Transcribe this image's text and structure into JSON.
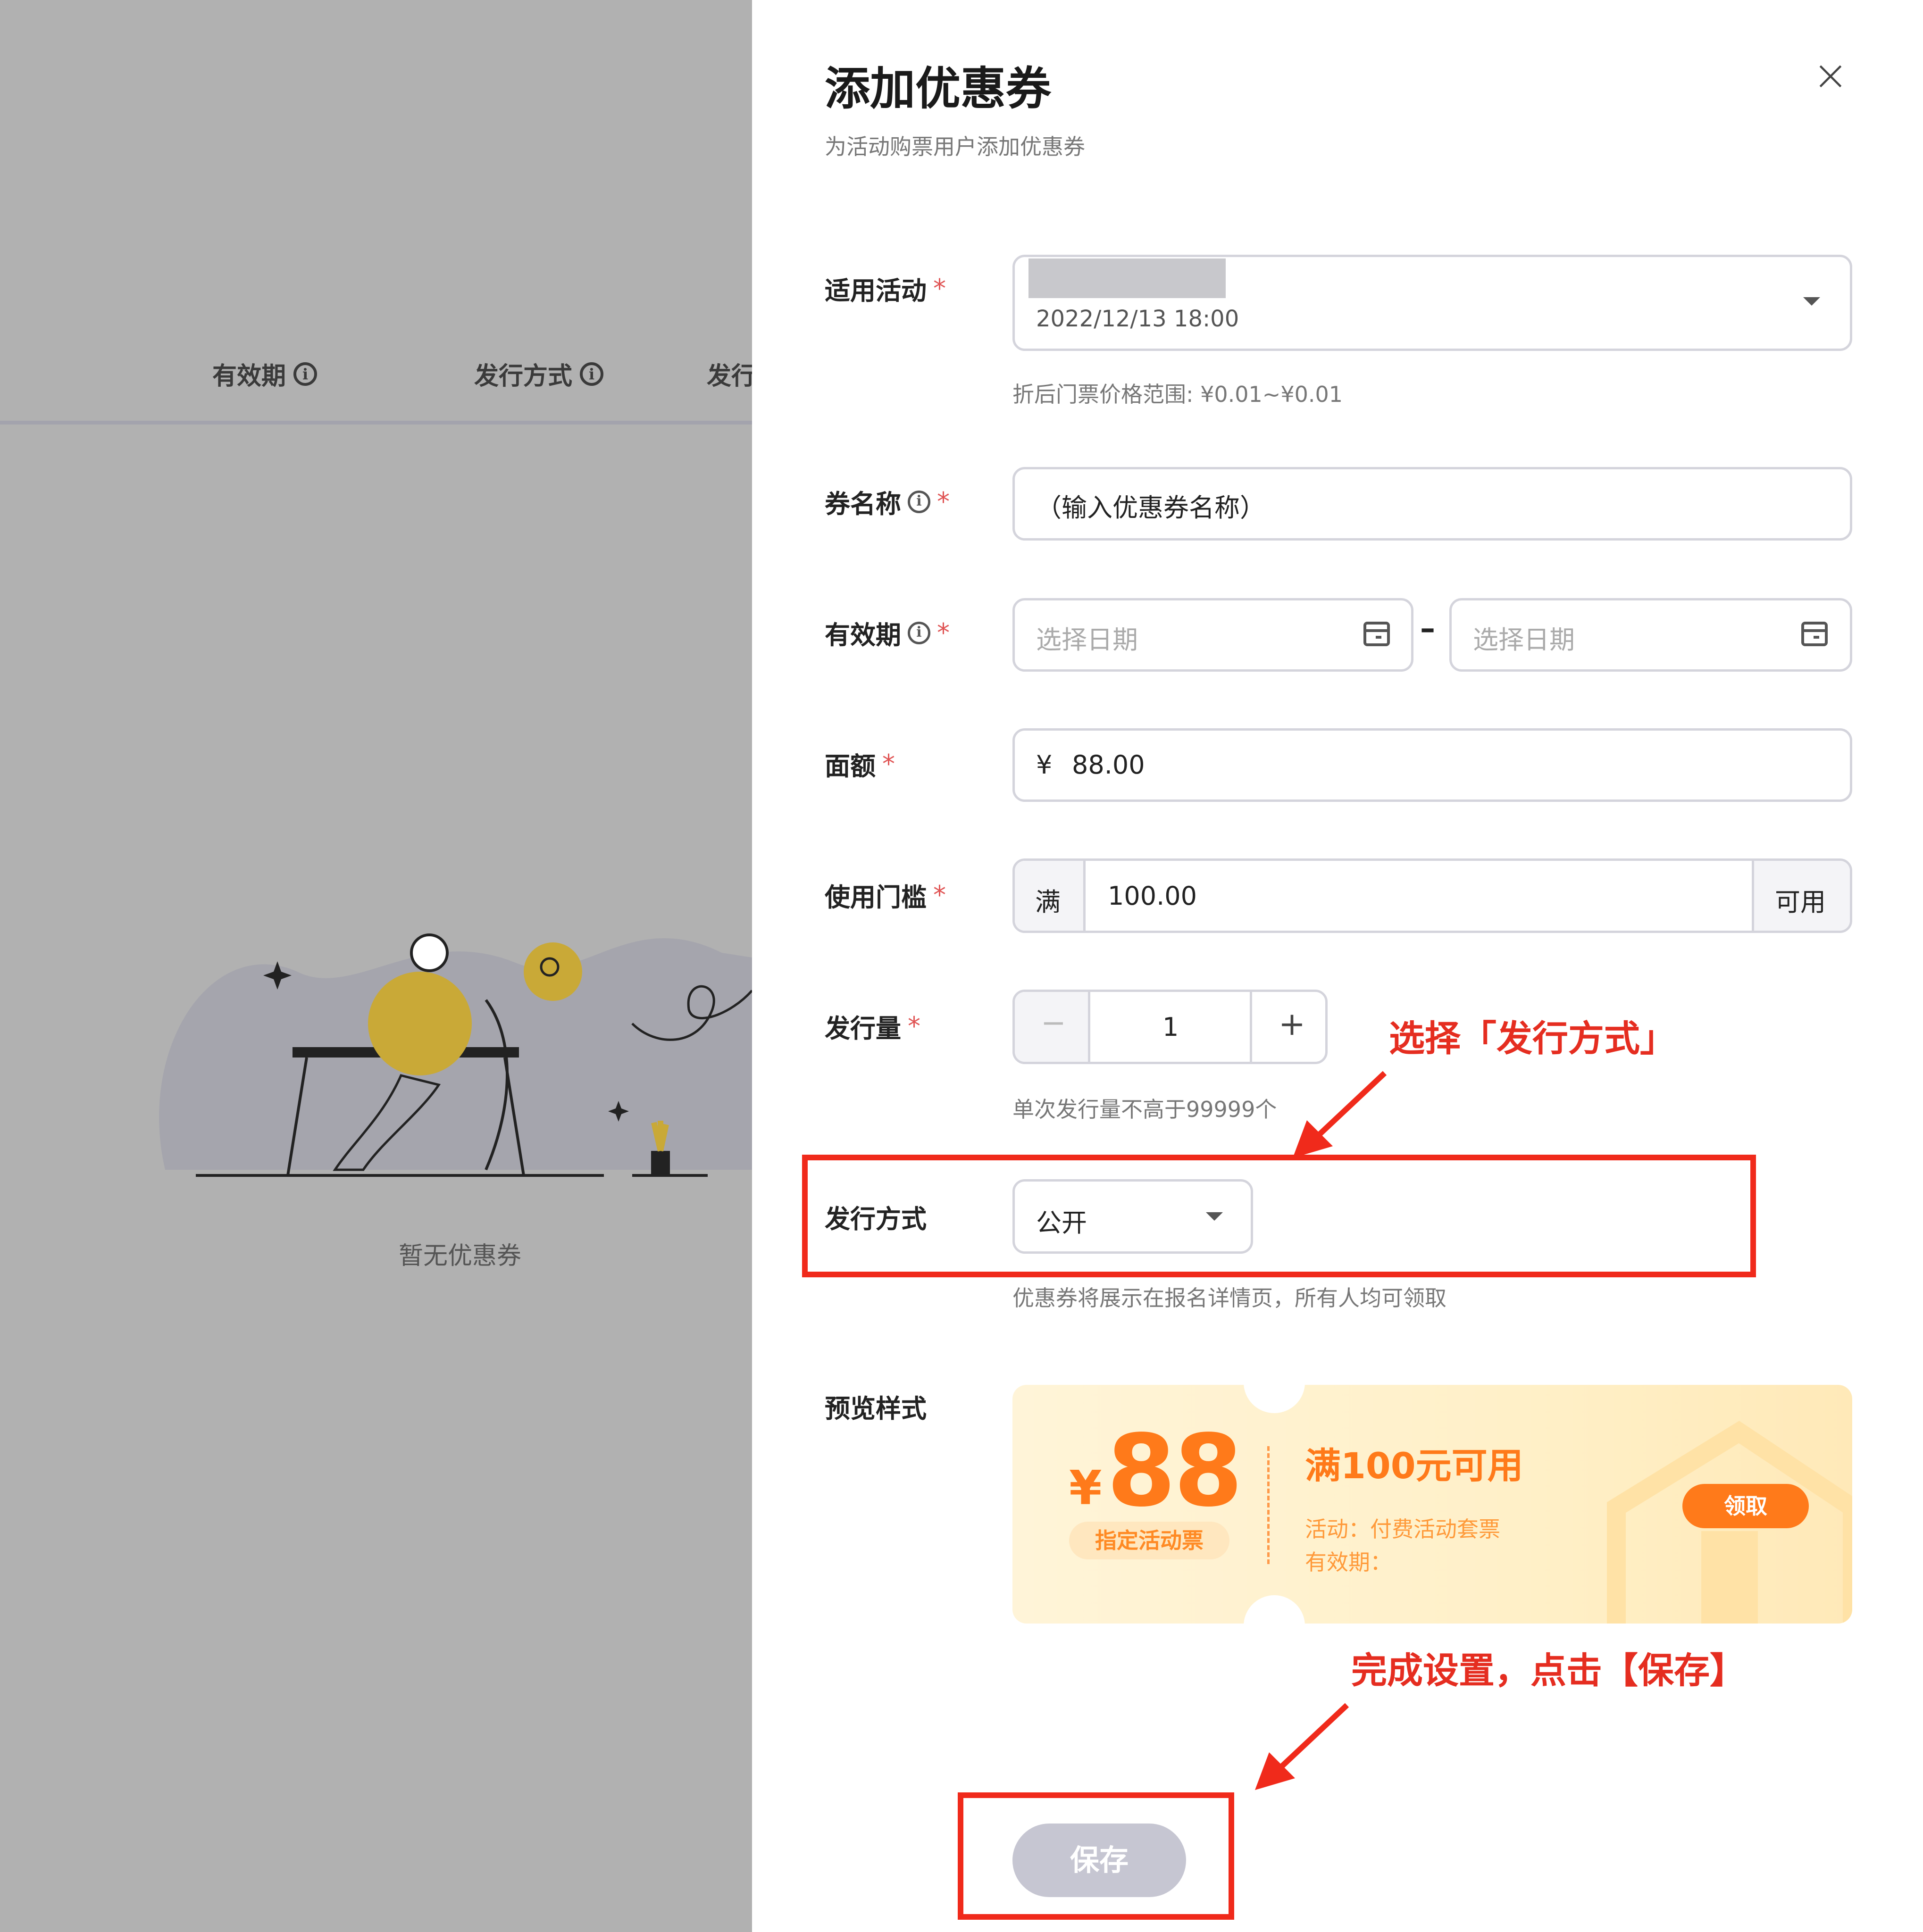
{
  "background": {
    "columns": [
      "有效期",
      "发行方式",
      "发行"
    ],
    "empty_text": "暂无优惠券"
  },
  "drawer": {
    "title": "添加优惠券",
    "subtitle": "为活动购票用户添加优惠券",
    "close_icon": "close-icon"
  },
  "form": {
    "activity": {
      "label": "适用活动",
      "value": "2022/12/13 18:00",
      "hint": "折后门票价格范围: ¥0.01~¥0.01"
    },
    "coupon_name": {
      "label": "券名称",
      "placeholder": "（输入优惠券名称）"
    },
    "validity": {
      "label": "有效期",
      "start_placeholder": "选择日期",
      "end_placeholder": "选择日期",
      "separator": "–"
    },
    "face_value": {
      "label": "面额",
      "prefix": "¥",
      "value": "88.00"
    },
    "threshold": {
      "label": "使用门槛",
      "prefix": "满",
      "value": "100.00",
      "suffix": "可用"
    },
    "quantity": {
      "label": "发行量",
      "minus": "−",
      "value": "1",
      "plus": "+",
      "hint": "单次发行量不高于99999个"
    },
    "issue_method": {
      "label": "发行方式",
      "value": "公开",
      "hint": "优惠券将展示在报名详情页，所有人均可领取"
    },
    "preview": {
      "label": "预览样式"
    },
    "required_mark": "*",
    "info_mark": "i"
  },
  "coupon_preview": {
    "yen": "¥",
    "amount": "88",
    "tag": "指定活动票",
    "condition": "满100元可用",
    "activity_line": "活动：付费活动套票",
    "validity_line": "有效期：",
    "claim": "领取"
  },
  "annotations": {
    "select_method": "选择「发行方式」",
    "save_hint": "完成设置，点击【保存】"
  },
  "save_button": "保存",
  "colors": {
    "accent_orange": "#ff7a1a",
    "annotation_red": "#e52d20",
    "save_disabled": "#c6c6d2"
  }
}
